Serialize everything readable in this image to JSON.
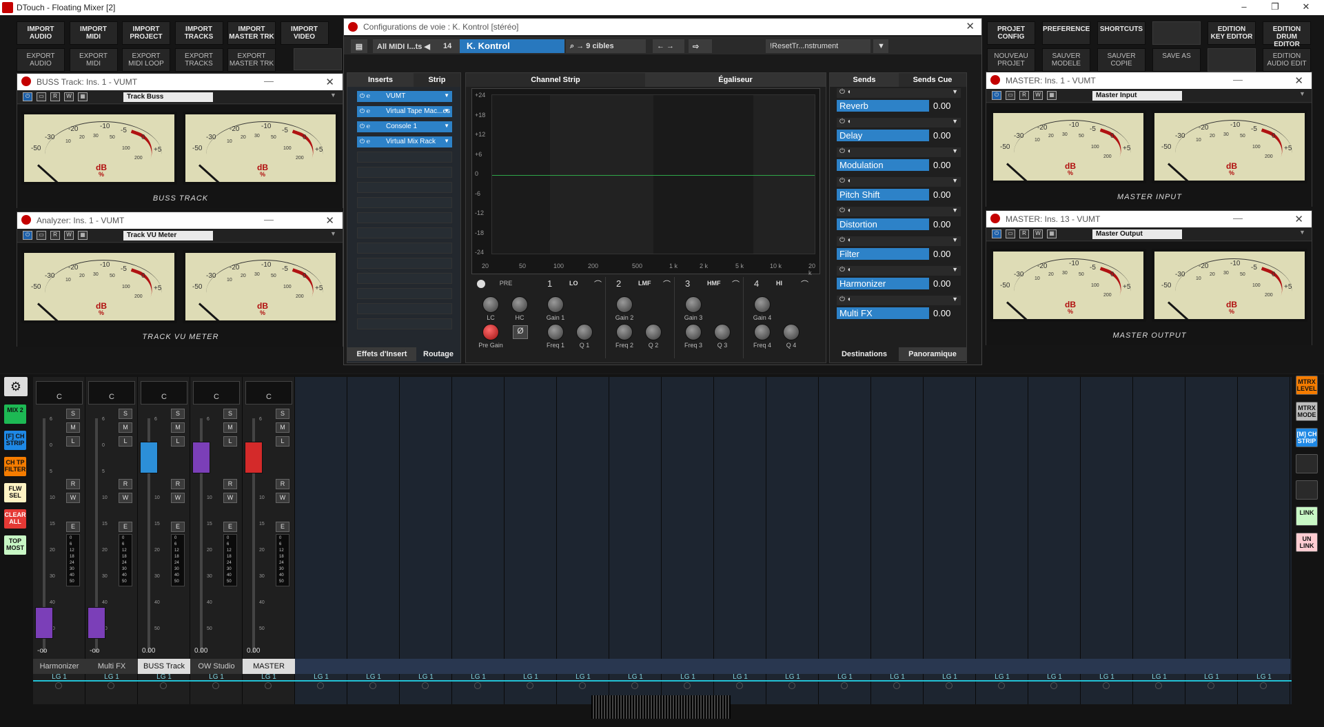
{
  "titlebar": {
    "title": "DTouch - Floating Mixer [2]",
    "min": "–",
    "restore": "❐",
    "close": "✕"
  },
  "top_left_buttons": [
    {
      "label": "IMPORT\nAUDIO",
      "name": "import-audio"
    },
    {
      "label": "IMPORT\nMIDI",
      "name": "import-midi"
    },
    {
      "label": "IMPORT\nPROJECT",
      "name": "import-project"
    },
    {
      "label": "IMPORT\nTRACKS",
      "name": "import-tracks"
    },
    {
      "label": "IMPORT\nMASTER TRK",
      "name": "import-master-trk"
    },
    {
      "label": "IMPORT\nVIDEO",
      "name": "import-video"
    }
  ],
  "top_left_buttons2": [
    {
      "label": "EXPORT\nAUDIO",
      "name": "export-audio"
    },
    {
      "label": "EXPORT\nMIDI",
      "name": "export-midi"
    },
    {
      "label": "EXPORT\nMIDI LOOP",
      "name": "export-midi-loop"
    },
    {
      "label": "EXPORT\nTRACKS",
      "name": "export-tracks"
    },
    {
      "label": "EXPORT\nMASTER TRK",
      "name": "export-master-trk"
    }
  ],
  "top_right_buttons": [
    {
      "label": "PROJET\nCONFIG",
      "name": "projet-config"
    },
    {
      "label": "PREFERENCE",
      "name": "preference"
    },
    {
      "label": "SHORTCUTS",
      "name": "shortcuts"
    },
    {
      "label": "",
      "name": "blank1"
    },
    {
      "label": "EDITION\nKEY EDITOR",
      "name": "edition-key-editor"
    },
    {
      "label": "EDITION\nDRUM EDITOR",
      "name": "edition-drum-editor"
    }
  ],
  "top_right_buttons2": [
    {
      "label": "NOUVEAU\nPROJET",
      "name": "nouveau-projet"
    },
    {
      "label": "SAUVER\nMODELE",
      "name": "sauver-modele"
    },
    {
      "label": "SAUVER\nCOPIE",
      "name": "sauver-copie"
    },
    {
      "label": "SAVE AS",
      "name": "save-as"
    },
    {
      "label": "",
      "name": "blank2"
    },
    {
      "label": "EDITION\nAUDIO EDIT",
      "name": "edition-audio-edit"
    }
  ],
  "plugin_windows": [
    {
      "title": "BUSS Track: Ins. 1 - VUMT",
      "preset": "Track Buss",
      "label": "BUSS TRACK"
    },
    {
      "title": "Analyzer: Ins. 1 - VUMT",
      "preset": "Track VU Meter",
      "label": "TRACK VU METER"
    },
    {
      "title": "MASTER: Ins. 1 - VUMT",
      "preset": "Master Input",
      "label": "MASTER INPUT"
    },
    {
      "title": "MASTER: Ins. 13 - VUMT",
      "preset": "Master Output",
      "label": "MASTER OUTPUT"
    }
  ],
  "vu": {
    "db": "dB",
    "pct": "%",
    "scale": [
      "-50",
      "-30",
      "-20",
      "-10",
      "-5",
      "0",
      "+5"
    ],
    "small": [
      "10",
      "20",
      "30",
      "50",
      "100",
      "200"
    ]
  },
  "channel_settings": {
    "title": "Configurations de voie : K. Kontrol [stéréo]",
    "midi_filter": "All MIDI I...ts",
    "channel_num": "14",
    "channel_name": "K. Kontrol",
    "targets": "9 cibles",
    "preset": "!ResetTr...nstrument",
    "tabs": {
      "inserts": "Inserts",
      "strip": "Strip",
      "channel_strip": "Channel Strip",
      "eq": "Égaliseur",
      "sends": "Sends",
      "sends_cue": "Sends Cue"
    },
    "inserts": [
      "VUMT",
      "Virtual Tape Mac...es",
      "Console 1",
      "Virtual Mix Rack"
    ],
    "bottom_tabs": {
      "effets": "Effets d'Insert",
      "routage": "Routage",
      "destinations": "Destinations",
      "panoramique": "Panoramique"
    },
    "eq": {
      "y_ticks": [
        "+24",
        "+18",
        "+12",
        "+6",
        "0",
        "-6",
        "-12",
        "-18",
        "-24"
      ],
      "x_ticks": [
        "20",
        "50",
        "100",
        "200",
        "500",
        "1 k",
        "2 k",
        "5 k",
        "10 k",
        "20 k"
      ],
      "pre": "PRE",
      "lc": "LC",
      "hc": "HC",
      "pre_gain": "Pre Gain",
      "phase": "Ø",
      "bands": [
        {
          "n": "1",
          "type": "LO",
          "gain": "Gain 1",
          "freq": "Freq 1",
          "q": "Q 1"
        },
        {
          "n": "2",
          "type": "LMF",
          "gain": "Gain 2",
          "freq": "Freq 2",
          "q": "Q 2"
        },
        {
          "n": "3",
          "type": "HMF",
          "gain": "Gain 3",
          "freq": "Freq 3",
          "q": "Q 3"
        },
        {
          "n": "4",
          "type": "HI",
          "gain": "Gain 4",
          "freq": "Freq 4",
          "q": "Q 4"
        }
      ]
    },
    "sends": [
      {
        "name": "Reverb",
        "value": "0.00"
      },
      {
        "name": "Delay",
        "value": "0.00"
      },
      {
        "name": "Modulation",
        "value": "0.00"
      },
      {
        "name": "Pitch Shift",
        "value": "0.00"
      },
      {
        "name": "Distortion",
        "value": "0.00"
      },
      {
        "name": "Filter",
        "value": "0.00"
      },
      {
        "name": "Harmonizer",
        "value": "0.00"
      },
      {
        "name": "Multi FX",
        "value": "0.00"
      }
    ]
  },
  "mixer": {
    "left_buttons": [
      {
        "label": "MIX 2",
        "color": "#1db954"
      },
      {
        "label": "[F] CH\nSTRIP",
        "color": "#1e88e5"
      },
      {
        "label": "CH TP\nFILTER",
        "color": "#f57c00"
      },
      {
        "label": "FLW\nSEL",
        "color": "#fff3c4"
      },
      {
        "label": "CLEAR\nALL",
        "color": "#e53935"
      },
      {
        "label": "TOP\nMOST",
        "color": "#c8f7c5"
      }
    ],
    "right_buttons": [
      {
        "label": "MTRX\nLEVEL",
        "color": "#f57c00"
      },
      {
        "label": "MTRX\nMODE",
        "color": "#bdbdbd"
      },
      {
        "label": "[M] CH\nSTRIP",
        "color": "#1e88e5"
      },
      {
        "label": "",
        "color": "#2a2a2a"
      },
      {
        "label": "",
        "color": "#2a2a2a"
      },
      {
        "label": "LINK",
        "color": "#c8f7c5"
      },
      {
        "label": "UN\nLINK",
        "color": "#ffcdd2"
      }
    ],
    "pan_value": "C",
    "btn": {
      "s": "S",
      "m": "M",
      "l": "L",
      "r": "R",
      "w": "W",
      "e": "E"
    },
    "fader_scale": [
      "6",
      "0",
      "5",
      "10",
      "15",
      "20",
      "30",
      "40",
      "50"
    ],
    "meter_scale": [
      "0",
      "6",
      "12",
      "18",
      "24",
      "30",
      "40",
      "50"
    ],
    "channels": [
      {
        "name": "Harmonizer",
        "vol": "-oo",
        "color": "#7b3fb8"
      },
      {
        "name": "Multi FX",
        "vol": "-oo",
        "color": "#7b3fb8"
      },
      {
        "name": "BUSS Track",
        "vol": "0.00",
        "color": "#2c8fd8"
      },
      {
        "name": "OW Studio",
        "vol": "0.00",
        "color": "#7b3fb8"
      },
      {
        "name": "MASTER",
        "vol": "0.00",
        "color": "#d42a2a"
      }
    ],
    "lg_label": "LG 1"
  }
}
